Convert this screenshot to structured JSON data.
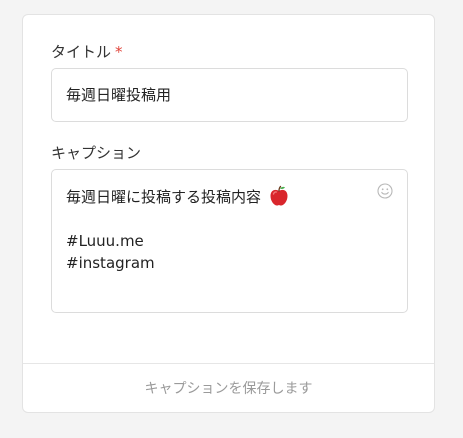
{
  "form": {
    "title_label": "タイトル",
    "required_mark": "*",
    "title_value": "毎週日曜投稿用",
    "caption_label": "キャプション",
    "caption_lines": [
      "毎週日曜に投稿する投稿内容",
      "#Luuu.me",
      "#instagram"
    ],
    "save_label": "キャプションを保存します"
  },
  "icons": {
    "caption_emoji": "red-apple-icon",
    "emoji_picker": "smiley-icon"
  },
  "colors": {
    "required": "#e0443a",
    "apple": "#d9262c",
    "button_text": "#9a9a9a"
  }
}
